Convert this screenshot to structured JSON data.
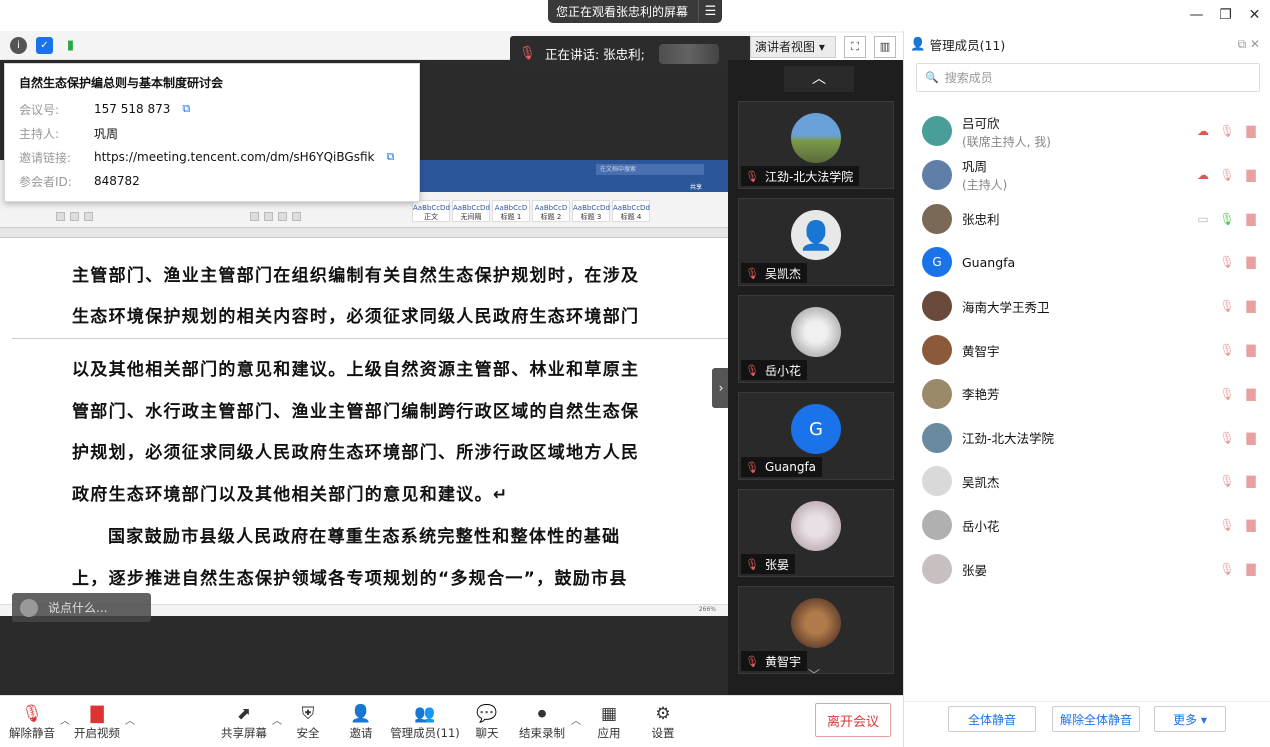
{
  "banner": {
    "text": "您正在观看张忠利的屏幕",
    "menu_icon": "menu-icon"
  },
  "window": {
    "minimize": "—",
    "maximize": "❐",
    "close": "✕"
  },
  "speaking": {
    "label": "正在讲话: 张忠利;"
  },
  "view_mode": {
    "label": "演讲者视图 ▾"
  },
  "meeting_info": {
    "title": "自然生态保护编总则与基本制度研讨会",
    "rows": [
      {
        "key": "会议号:",
        "value": "157 518 873"
      },
      {
        "key": "主持人:",
        "value": "巩周"
      },
      {
        "key": "邀请链接:",
        "value": "https://meeting.tencent.com/dm/sH6YQiBGsfik"
      },
      {
        "key": "参会者ID:",
        "value": "848782"
      }
    ]
  },
  "document": {
    "lines": [
      "主管部门、渔业主管部门在组织编制有关自然生态保护规划时，在涉及",
      "生态环境保护规划的相关内容时，必须征求同级人民政府生态环境部门",
      "以及其他相关部门的意见和建议。上级自然资源主管部、林业和草原主",
      "管部门、水行政主管部门、渔业主管部门编制跨行政区域的自然生态保",
      "护规划，必须征求同级人民政府生态环境部门、所涉行政区域地方人民",
      "政府生态环境部门以及其他相关部门的意见和建议。↵",
      "国家鼓励市县级人民政府在尊重生态系统完整性和整体性的基础",
      "上，逐步推进自然生态保护领域各专项规划的“多规合一”，鼓励市县"
    ],
    "ribbon_search": "在文档中搜索",
    "ribbon_share": "共享",
    "styles": [
      "AaBbCcDd",
      "AaBbCcDd",
      "AaBbCcD",
      "AaBbCcD",
      "AaBbCcDd",
      "AaBbCcDd"
    ],
    "style_names": [
      "正文",
      "无间隔",
      "标题 1",
      "标题 2",
      "标题 3",
      "标题 4"
    ],
    "status_zoom": "266%"
  },
  "chat_input": {
    "placeholder": "说点什么..."
  },
  "video_tiles": [
    {
      "name": "江劲-北大法学院",
      "avatar": "photo"
    },
    {
      "name": "吴凯杰",
      "avatar": "default"
    },
    {
      "name": "岳小花",
      "avatar": "photo"
    },
    {
      "name": "Guangfa",
      "avatar": "G"
    },
    {
      "name": "张晏",
      "avatar": "photo"
    },
    {
      "name": "黄智宇",
      "avatar": "photo"
    }
  ],
  "panel": {
    "title": "管理成员(11)",
    "search_placeholder": "搜索成员",
    "members": [
      {
        "name": "吕可欣",
        "sub": "(联席主持人, 我)",
        "avatar_color": "#4a9e9a"
      },
      {
        "name": "巩周",
        "sub": "(主持人)",
        "avatar_color": "#5f7fa8"
      },
      {
        "name": "张忠利",
        "sub": "",
        "avatar_color": "#7a6a55"
      },
      {
        "name": "Guangfa",
        "sub": "",
        "avatar_color": "#1a73e8",
        "letter": "G"
      },
      {
        "name": "海南大学王秀卫",
        "sub": "",
        "avatar_color": "#6a4a3a"
      },
      {
        "name": "黄智宇",
        "sub": "",
        "avatar_color": "#8a5a3a"
      },
      {
        "name": "李艳芳",
        "sub": "",
        "avatar_color": "#9a8a6a"
      },
      {
        "name": "江劲-北大法学院",
        "sub": "",
        "avatar_color": "#6a8aa0"
      },
      {
        "name": "吴凯杰",
        "sub": "",
        "avatar_color": "#d9d9d9"
      },
      {
        "name": "岳小花",
        "sub": "",
        "avatar_color": "#b0b0b0"
      },
      {
        "name": "张晏",
        "sub": "",
        "avatar_color": "#c8c0c0"
      }
    ],
    "buttons": {
      "mute_all": "全体静音",
      "unmute_all": "解除全体静音",
      "more": "更多 ▾"
    }
  },
  "bottombar": {
    "unmute": "解除静音",
    "video": "开启视频",
    "share": "共享屏幕",
    "security": "安全",
    "invite": "邀请",
    "members": "管理成员(11)",
    "chat": "聊天",
    "record": "结束录制",
    "apps": "应用",
    "settings": "设置",
    "leave": "离开会议"
  }
}
